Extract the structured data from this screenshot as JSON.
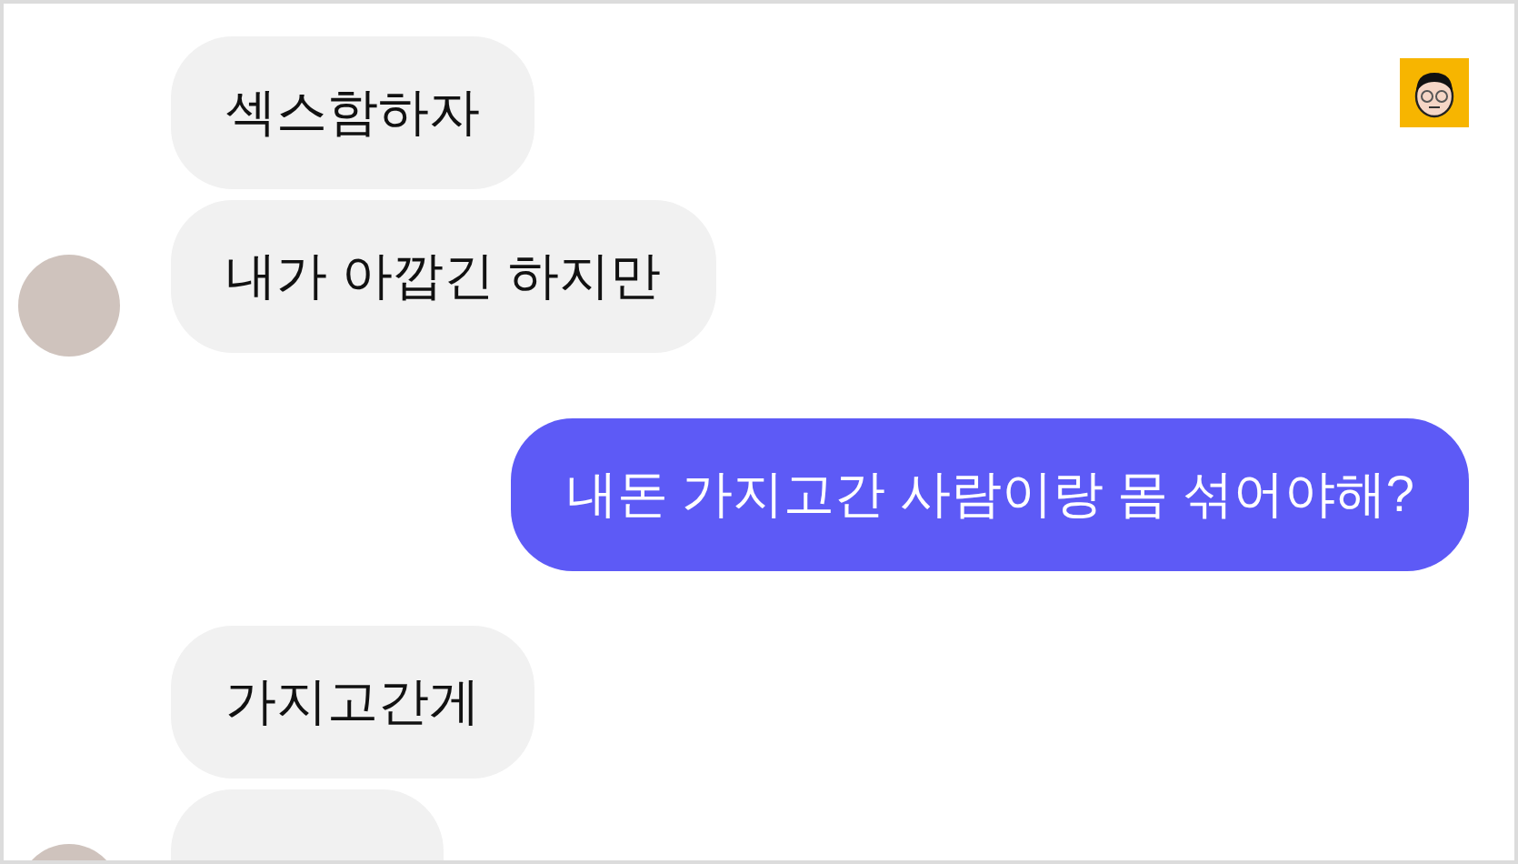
{
  "messages": [
    {
      "kind": "incoming",
      "text": "섹스함하자",
      "avatar": false
    },
    {
      "kind": "incoming",
      "text": "내가 아깝긴 하지만",
      "avatar": true
    },
    {
      "kind": "outgoing",
      "text": "내돈 가지고간 사람이랑 몸 섞어야해?"
    },
    {
      "kind": "incoming",
      "text": "가지고간게",
      "avatar": false
    },
    {
      "kind": "incoming",
      "avatar": true
    }
  ]
}
